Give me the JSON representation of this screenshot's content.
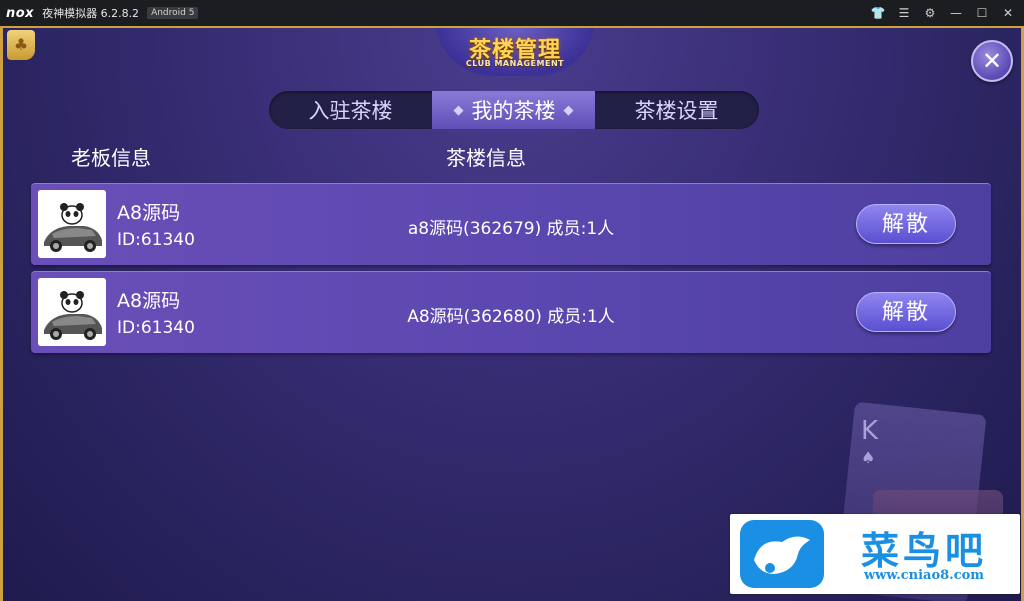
{
  "titlebar": {
    "logo": "nox",
    "app_title": "夜神模拟器 6.2.8.2",
    "android_badge": "Android 5",
    "controls": [
      "shirt-icon",
      "menu-icon",
      "gear-icon",
      "minimize-icon",
      "maximize-icon",
      "close-icon"
    ]
  },
  "header": {
    "title": "茶楼管理",
    "subtitle": "CLUB MANAGEMENT"
  },
  "tabs": [
    {
      "label": "入驻茶楼",
      "active": false
    },
    {
      "label": "我的茶楼",
      "active": true
    },
    {
      "label": "茶楼设置",
      "active": false
    }
  ],
  "columns": {
    "boss": "老板信息",
    "club": "茶楼信息"
  },
  "rows": [
    {
      "name": "A8源码",
      "id": "ID:61340",
      "club": "a8源码(362679) 成员:1人",
      "action": "解散"
    },
    {
      "name": "A8源码",
      "id": "ID:61340",
      "club": "A8源码(362680) 成员:1人",
      "action": "解散"
    }
  ],
  "background": {
    "card_rank": "K"
  },
  "watermark": {
    "text": "菜鸟吧",
    "url": "www.cniao8.com"
  },
  "colors": {
    "gold": "#cfa040",
    "title_gold": "#ffd457",
    "row_purple": "#5c48b0",
    "button_blue": "#7a70e8",
    "watermark_blue": "#1a8fe3"
  }
}
